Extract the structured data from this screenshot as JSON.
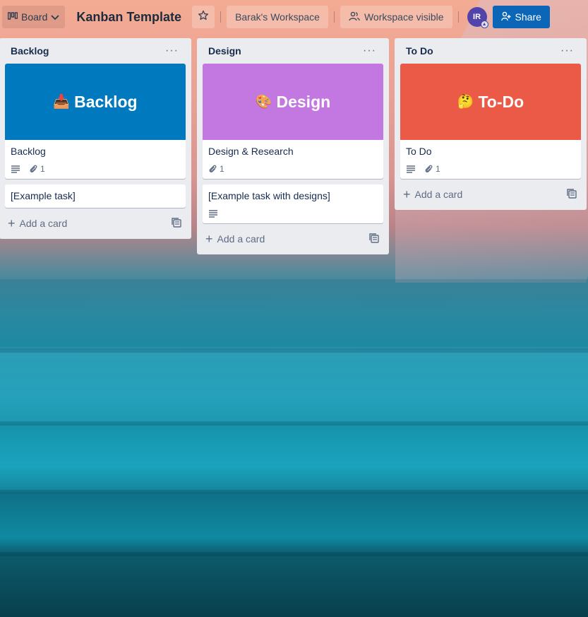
{
  "header": {
    "view_label": "Board",
    "board_title": "Kanban Template",
    "workspace_label": "Barak's Workspace",
    "visibility_label": "Workspace visible",
    "avatar_initials": "IR",
    "share_label": "Share"
  },
  "colors": {
    "backlog_cover": "#0079bf",
    "design_cover": "#c377e0",
    "todo_cover": "#eb5a46",
    "share_button": "#0c66b8",
    "avatar": "#5243aa"
  },
  "lists": [
    {
      "title": "Backlog",
      "cover_emoji": "📥",
      "cover_text": "Backlog",
      "cards": [
        {
          "title": "Backlog",
          "attachments": "1"
        },
        {
          "title": "[Example task]"
        }
      ],
      "add_label": "Add a card"
    },
    {
      "title": "Design",
      "cover_emoji": "🎨",
      "cover_text": "Design",
      "cards": [
        {
          "title": "Design & Research",
          "attachments": "1"
        },
        {
          "title": "[Example task with designs]"
        }
      ],
      "add_label": "Add a card"
    },
    {
      "title": "To Do",
      "cover_emoji": "🤔",
      "cover_text": "To-Do",
      "cards": [
        {
          "title": "To Do",
          "attachments": "1"
        }
      ],
      "add_label": "Add a card"
    }
  ]
}
